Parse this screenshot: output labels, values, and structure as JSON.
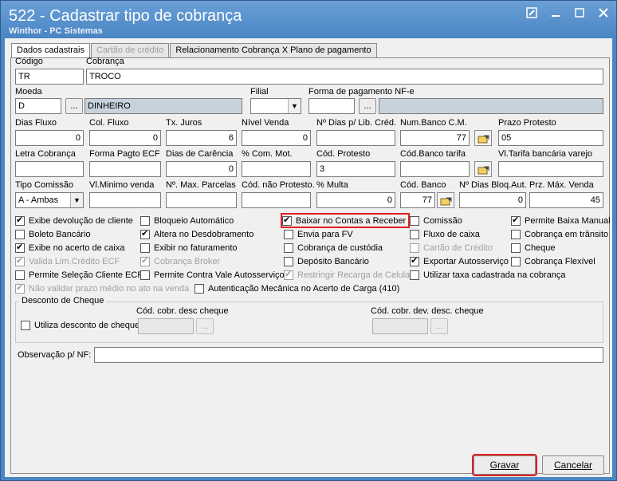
{
  "window": {
    "title": "522 - Cadastrar tipo de cobrança",
    "subtitle": "Winthor - PC Sistemas"
  },
  "tabs": [
    {
      "label": "Dados cadastrais"
    },
    {
      "label": "Cartão de crédito"
    },
    {
      "label": "Relacionamento Cobrança X Plano de pagamento"
    }
  ],
  "fields": {
    "codigo": {
      "label": "Código",
      "value": "TR"
    },
    "cobranca": {
      "label": "Cobrança",
      "value": "TROCO"
    },
    "moeda": {
      "label": "Moeda",
      "value": "D",
      "desc": "DINHEIRO"
    },
    "filial": {
      "label": "Filial",
      "value": ""
    },
    "forma_pag_nfe": {
      "label": "Forma de pagamento NF-e",
      "value": ""
    },
    "dias_fluxo": {
      "label": "Dias Fluxo",
      "value": "0"
    },
    "col_fluxo": {
      "label": "Col. Fluxo",
      "value": "0"
    },
    "tx_juros": {
      "label": "Tx. Juros",
      "value": "6"
    },
    "nivel_venda": {
      "label": "Nível Venda",
      "value": "0"
    },
    "dias_lib_cred": {
      "label": "Nº Dias p/ Lib. Créd.",
      "value": ""
    },
    "num_banco_cm": {
      "label": "Num.Banco C.M.",
      "value": "77"
    },
    "prazo_protesto": {
      "label": "Prazo Protesto",
      "value": "05"
    },
    "letra_cobranca": {
      "label": "Letra Cobrança",
      "value": ""
    },
    "forma_pagto_ecf": {
      "label": "Forma Pagto ECF",
      "value": ""
    },
    "dias_carencia": {
      "label": "Dias de Carência",
      "value": "0"
    },
    "com_mot": {
      "label": "% Com. Mot.",
      "value": ""
    },
    "cod_protesto": {
      "label": "Cód. Protesto",
      "value": "3"
    },
    "cod_banco_tarifa": {
      "label": "Cód.Banco tarifa",
      "value": ""
    },
    "vl_tarifa": {
      "label": "Vl.Tarifa bancária varejo",
      "value": ""
    },
    "tipo_comissao": {
      "label": "Tipo Comissão",
      "value": "A - Ambas"
    },
    "vl_minimo_venda": {
      "label": "Vl.Minimo venda",
      "value": ""
    },
    "max_parcelas": {
      "label": "Nº. Max. Parcelas",
      "value": ""
    },
    "cod_nao_protesto": {
      "label": "Cód. não Protesto.",
      "value": ""
    },
    "multa": {
      "label": "% Multa",
      "value": "0"
    },
    "cod_banco": {
      "label": "Cód. Banco",
      "value": "77"
    },
    "dias_bloq_aut": {
      "label": "Nº Dias Bloq.Aut.",
      "value": "0"
    },
    "prz_max_venda": {
      "label": "Prz. Máx. Venda",
      "value": "45"
    }
  },
  "checkboxes": [
    {
      "label": "Exibe devolução de cliente",
      "checked": true,
      "disabled": false
    },
    {
      "label": "Boleto Bancário",
      "checked": false,
      "disabled": false
    },
    {
      "label": "Exibe no acerto de caixa",
      "checked": true,
      "disabled": false
    },
    {
      "label": "Valida Lim.Crédito ECF",
      "checked": true,
      "disabled": true
    },
    {
      "label": "Permite Seleção Cliente ECF",
      "checked": false,
      "disabled": false
    },
    {
      "label": "Não validar prazo médio no ato na venda",
      "checked": true,
      "disabled": true
    },
    {
      "label": "Bloqueio Automático",
      "checked": false,
      "disabled": false
    },
    {
      "label": "Altera no Desdobramento",
      "checked": true,
      "disabled": false
    },
    {
      "label": "Exibir no faturamento",
      "checked": false,
      "disabled": false
    },
    {
      "label": "Cobrança Broker",
      "checked": true,
      "disabled": true
    },
    {
      "label": "Permite Contra Vale Autosserviço",
      "checked": false,
      "disabled": false
    },
    {
      "label": "Autenticação Mecânica no Acerto de Carga (410)",
      "checked": false,
      "disabled": false
    },
    {
      "label": "Baixar no Contas a Receber",
      "checked": true,
      "disabled": false
    },
    {
      "label": "Envia para FV",
      "checked": false,
      "disabled": false
    },
    {
      "label": "Cobrança de custódia",
      "checked": false,
      "disabled": false
    },
    {
      "label": "Depósito Bancário",
      "checked": false,
      "disabled": false
    },
    {
      "label": "Restringir Recarga de Celular",
      "checked": true,
      "disabled": true
    },
    {
      "label": "Comissão",
      "checked": false,
      "disabled": false
    },
    {
      "label": "Fluxo de caixa",
      "checked": false,
      "disabled": false
    },
    {
      "label": "Cartão de Crédito",
      "checked": false,
      "disabled": true
    },
    {
      "label": "Exportar Autosserviço",
      "checked": true,
      "disabled": false
    },
    {
      "label": "Utilizar taxa cadastrada na cobrança",
      "checked": false,
      "disabled": false
    },
    {
      "label": "Permite Baixa Manual",
      "checked": true,
      "disabled": false
    },
    {
      "label": "Cobrança em trânsito",
      "checked": false,
      "disabled": false
    },
    {
      "label": "Cheque",
      "checked": false,
      "disabled": false
    },
    {
      "label": "Cobrança Flexível",
      "checked": false,
      "disabled": false
    }
  ],
  "desconto_cheque": {
    "title": "Desconto de Cheque",
    "utiliza_label": "Utiliza desconto de cheque",
    "utiliza_checked": false,
    "cod_desc_label": "Cód. cobr. desc cheque",
    "cod_dev_label": "Cód. cobr. dev. desc. cheque"
  },
  "observacao": {
    "label": "Observação p/ NF:",
    "value": ""
  },
  "buttons": {
    "ellipsis": "...",
    "gravar": "Gravar",
    "cancelar": "Cancelar"
  }
}
